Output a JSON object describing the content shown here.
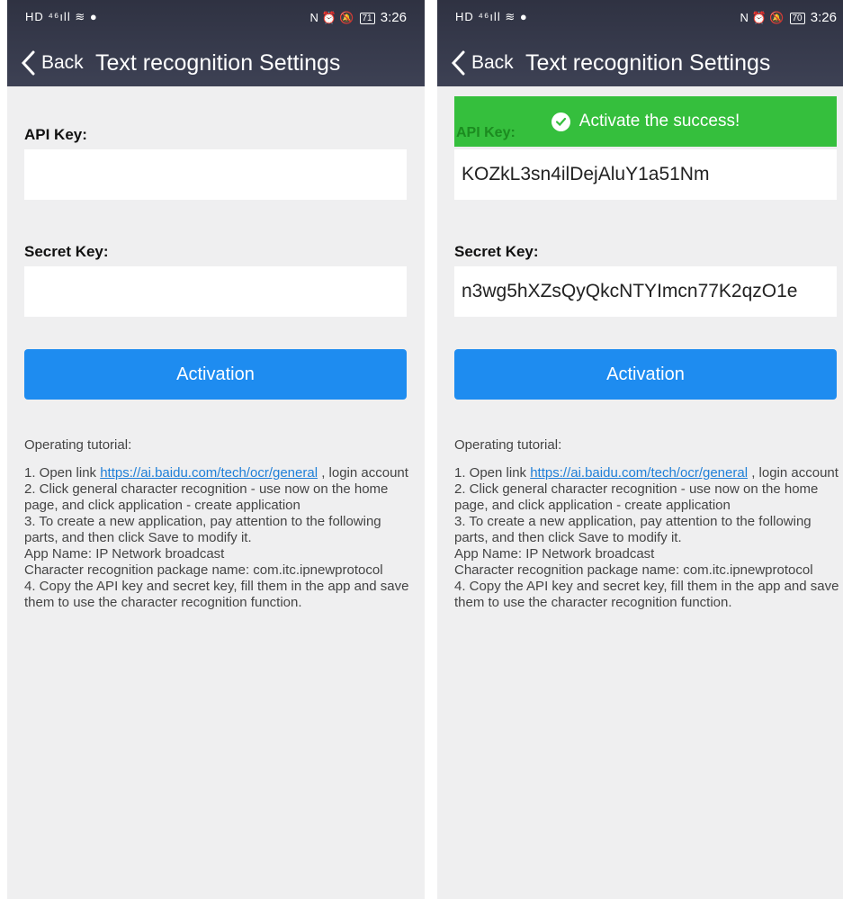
{
  "screens": [
    {
      "status_left": "HD ⁴⁶ıll ≋ ●",
      "status_icons": "N ⏰ 🔕",
      "battery": "71",
      "time": "3:26",
      "back_label": "Back",
      "title": "Text recognition Settings",
      "api_key_label": "API Key:",
      "api_key_value": "",
      "secret_key_label": "Secret Key:",
      "secret_key_value": "",
      "activation_label": "Activation",
      "tutorial_title": "Operating tutorial:",
      "step1_prefix": "1. Open link ",
      "step1_link": "https://ai.baidu.com/tech/ocr/general",
      "step1_suffix": " , login account",
      "step2": "2. Click general character recognition - use now on the home page, and click application - create application",
      "step3": "3. To create a new application, pay attention to the following parts, and then click Save to modify it.",
      "step3_app_name": " App Name: IP Network broadcast",
      "step3_package": " Character recognition package name: com.itc.ipnewprotocol",
      "step4": "4. Copy the API key and secret key, fill them in the app and save them to use the character recognition function."
    },
    {
      "status_left": "HD ⁴⁶ıll ≋ ●",
      "status_icons": "N ⏰ 🔕",
      "battery": "70",
      "time": "3:26",
      "back_label": "Back",
      "title": "Text recognition Settings",
      "toast": "Activate the success!",
      "api_key_label": "API Key:",
      "api_key_value": "KOZkL3sn4ilDejAluY1a51Nm",
      "secret_key_label": "Secret Key:",
      "secret_key_value": "n3wg5hXZsQyQkcNTYImcn77K2qzO1e",
      "activation_label": "Activation",
      "tutorial_title": "Operating tutorial:",
      "step1_prefix": "1. Open link ",
      "step1_link": "https://ai.baidu.com/tech/ocr/general",
      "step1_suffix": " , login account",
      "step2": "2. Click general character recognition - use now on the home page, and click application - create application",
      "step3": "3. To create a new application, pay attention to the following parts, and then click Save to modify it.",
      "step3_app_name": " App Name: IP Network broadcast",
      "step3_package": " Character recognition package name: com.itc.ipnewprotocol",
      "step4": "4. Copy the API key and secret key, fill them in the app and save them to use the character recognition function."
    }
  ],
  "colors": {
    "header": "#343748",
    "background": "#efeff0",
    "button": "#1e8cf0",
    "toast": "#35bf3d",
    "link": "#1e7fd8"
  }
}
